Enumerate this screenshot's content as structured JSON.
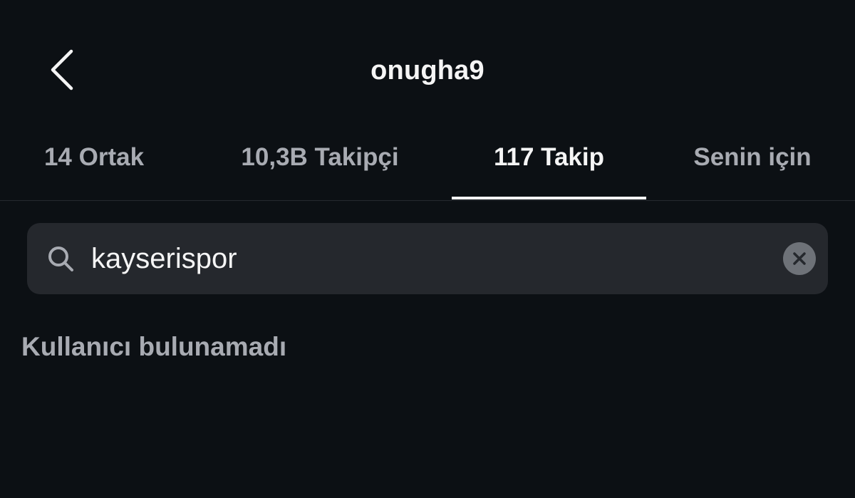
{
  "header": {
    "title": "onugha9",
    "back_icon": "chevron-left-icon"
  },
  "tabs": [
    {
      "label": "14 Ortak",
      "active": false
    },
    {
      "label": "10,3B Takipçi",
      "active": false
    },
    {
      "label": "117 Takip",
      "active": true
    },
    {
      "label": "Senin için",
      "active": false
    }
  ],
  "search": {
    "value": "kayserispor",
    "icon": "search-icon",
    "clear_icon": "clear-icon"
  },
  "results": {
    "empty_message": "Kullanıcı bulunamadı"
  },
  "colors": {
    "background": "#0c1014",
    "text_primary": "#f5f5f5",
    "text_secondary": "#a8abb2",
    "search_background": "#25282d",
    "active_indicator": "#f5f5f5"
  }
}
